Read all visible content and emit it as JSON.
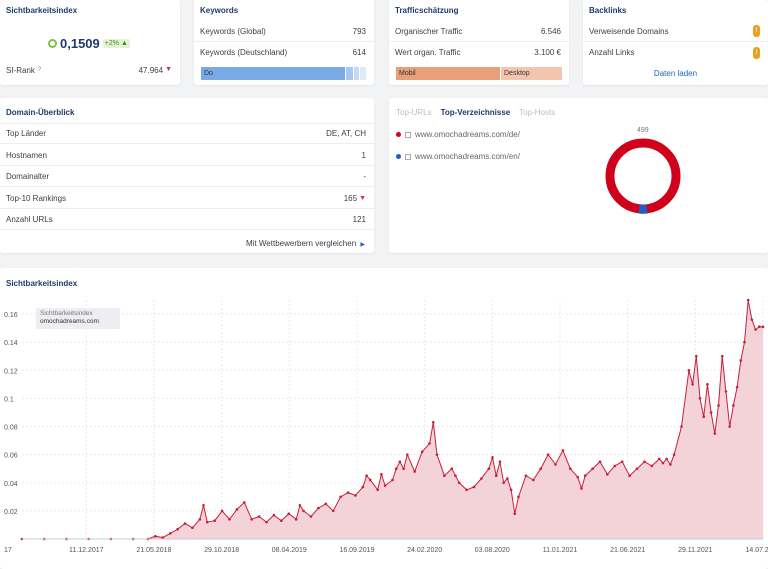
{
  "si_card": {
    "title": "Sichtbarkeitsindex",
    "value": "0,1509",
    "change": "+2%",
    "rank_label": "SI-Rank",
    "rank_help": "?",
    "rank_value": "47.964"
  },
  "keywords_card": {
    "title": "Keywords",
    "rows": [
      {
        "label": "Keywords (Global)",
        "value": "793"
      },
      {
        "label": "Keywords (Deutschland)",
        "value": "614"
      }
    ],
    "bar_label": "Do"
  },
  "traffic_card": {
    "title": "Trafficschätzung",
    "rows": [
      {
        "label": "Organischer Traffic",
        "value": "6.546"
      },
      {
        "label": "Wert organ. Traffic",
        "value": "3.100 €"
      }
    ],
    "mobile_label": "Mobil",
    "desktop_label": "Desktop"
  },
  "backlinks_card": {
    "title": "Backlinks",
    "rows": [
      {
        "label": "Verweisende Domains",
        "badge": "!"
      },
      {
        "label": "Anzahl Links",
        "badge": "!"
      }
    ],
    "load_label": "Daten laden"
  },
  "domain_card": {
    "title": "Domain-Überblick",
    "rows": [
      {
        "label": "Top Länder",
        "value": "DE, AT, CH"
      },
      {
        "label": "Hostnamen",
        "value": "1"
      },
      {
        "label": "Domainalter",
        "value": "-"
      },
      {
        "label": "Top-10 Rankings",
        "value": "165"
      },
      {
        "label": "Anzahl URLs",
        "value": "121"
      }
    ],
    "compare_label": "Mit Wettbewerbern vergleichen"
  },
  "dir_card": {
    "tabs": [
      "Top-URLs",
      "Top-Verzeichnisse",
      "Top-Hosts"
    ],
    "entries": [
      {
        "url": "www.omochadreams.com/de/",
        "color": "#d0021b"
      },
      {
        "url": "www.omochadreams.com/en/",
        "color": "#1f5fc2"
      }
    ],
    "donut_total": "499"
  },
  "chart_card": {
    "title": "Sichtbarkeitsindex",
    "tooltip_title": "Sichtbarkeitsindex",
    "tooltip_domain": "omochadreams.com"
  },
  "chart_data": {
    "type": "area",
    "color": "#c8203a",
    "fill": "#f3d2d8",
    "ylim": [
      0,
      0.17
    ],
    "yticks": [
      "0.16",
      "0.14",
      "0.12",
      "0.1",
      "0.08",
      "0.06",
      "0.04",
      "0.02"
    ],
    "xticks": [
      "17",
      "11.12.2017",
      "21.05.2018",
      "29.10.2018",
      "08.04.2019",
      "16.09.2019",
      "24.02.2020",
      "03.08.2020",
      "11.01.2021",
      "21.06.2021",
      "29.11.2021",
      "14.07.2022"
    ],
    "points": [
      [
        0,
        0
      ],
      [
        0.03,
        0
      ],
      [
        0.06,
        0
      ],
      [
        0.09,
        0
      ],
      [
        0.12,
        0
      ],
      [
        0.15,
        0
      ],
      [
        0.17,
        0
      ],
      [
        0.18,
        0.002
      ],
      [
        0.19,
        0.001
      ],
      [
        0.2,
        0.004
      ],
      [
        0.21,
        0.007
      ],
      [
        0.22,
        0.011
      ],
      [
        0.23,
        0.008
      ],
      [
        0.24,
        0.014
      ],
      [
        0.245,
        0.024
      ],
      [
        0.25,
        0.012
      ],
      [
        0.26,
        0.013
      ],
      [
        0.27,
        0.02
      ],
      [
        0.28,
        0.014
      ],
      [
        0.29,
        0.021
      ],
      [
        0.3,
        0.026
      ],
      [
        0.31,
        0.014
      ],
      [
        0.32,
        0.016
      ],
      [
        0.33,
        0.012
      ],
      [
        0.34,
        0.017
      ],
      [
        0.35,
        0.013
      ],
      [
        0.36,
        0.018
      ],
      [
        0.37,
        0.014
      ],
      [
        0.375,
        0.024
      ],
      [
        0.38,
        0.02
      ],
      [
        0.39,
        0.016
      ],
      [
        0.4,
        0.022
      ],
      [
        0.41,
        0.025
      ],
      [
        0.42,
        0.02
      ],
      [
        0.43,
        0.03
      ],
      [
        0.44,
        0.033
      ],
      [
        0.45,
        0.031
      ],
      [
        0.46,
        0.037
      ],
      [
        0.465,
        0.045
      ],
      [
        0.47,
        0.042
      ],
      [
        0.48,
        0.035
      ],
      [
        0.485,
        0.046
      ],
      [
        0.49,
        0.038
      ],
      [
        0.5,
        0.042
      ],
      [
        0.505,
        0.05
      ],
      [
        0.51,
        0.055
      ],
      [
        0.515,
        0.05
      ],
      [
        0.52,
        0.06
      ],
      [
        0.53,
        0.048
      ],
      [
        0.54,
        0.062
      ],
      [
        0.55,
        0.068
      ],
      [
        0.555,
        0.083
      ],
      [
        0.56,
        0.06
      ],
      [
        0.57,
        0.045
      ],
      [
        0.58,
        0.05
      ],
      [
        0.585,
        0.045
      ],
      [
        0.59,
        0.04
      ],
      [
        0.6,
        0.035
      ],
      [
        0.61,
        0.037
      ],
      [
        0.62,
        0.043
      ],
      [
        0.63,
        0.05
      ],
      [
        0.635,
        0.058
      ],
      [
        0.64,
        0.045
      ],
      [
        0.645,
        0.055
      ],
      [
        0.65,
        0.04
      ],
      [
        0.655,
        0.043
      ],
      [
        0.66,
        0.035
      ],
      [
        0.665,
        0.018
      ],
      [
        0.67,
        0.03
      ],
      [
        0.68,
        0.045
      ],
      [
        0.69,
        0.042
      ],
      [
        0.7,
        0.05
      ],
      [
        0.71,
        0.06
      ],
      [
        0.72,
        0.053
      ],
      [
        0.73,
        0.063
      ],
      [
        0.74,
        0.05
      ],
      [
        0.75,
        0.044
      ],
      [
        0.755,
        0.036
      ],
      [
        0.76,
        0.045
      ],
      [
        0.77,
        0.05
      ],
      [
        0.78,
        0.055
      ],
      [
        0.79,
        0.046
      ],
      [
        0.8,
        0.052
      ],
      [
        0.81,
        0.055
      ],
      [
        0.82,
        0.045
      ],
      [
        0.83,
        0.05
      ],
      [
        0.84,
        0.055
      ],
      [
        0.85,
        0.052
      ],
      [
        0.86,
        0.057
      ],
      [
        0.865,
        0.054
      ],
      [
        0.87,
        0.057
      ],
      [
        0.875,
        0.053
      ],
      [
        0.88,
        0.06
      ],
      [
        0.89,
        0.08
      ],
      [
        0.9,
        0.12
      ],
      [
        0.905,
        0.11
      ],
      [
        0.91,
        0.13
      ],
      [
        0.915,
        0.1
      ],
      [
        0.92,
        0.087
      ],
      [
        0.925,
        0.11
      ],
      [
        0.93,
        0.09
      ],
      [
        0.935,
        0.075
      ],
      [
        0.94,
        0.095
      ],
      [
        0.945,
        0.13
      ],
      [
        0.95,
        0.105
      ],
      [
        0.955,
        0.08
      ],
      [
        0.96,
        0.095
      ],
      [
        0.965,
        0.108
      ],
      [
        0.97,
        0.127
      ],
      [
        0.975,
        0.14
      ],
      [
        0.98,
        0.17
      ],
      [
        0.985,
        0.156
      ],
      [
        0.99,
        0.149
      ],
      [
        0.995,
        0.151
      ],
      [
        1,
        0.1509
      ]
    ]
  }
}
